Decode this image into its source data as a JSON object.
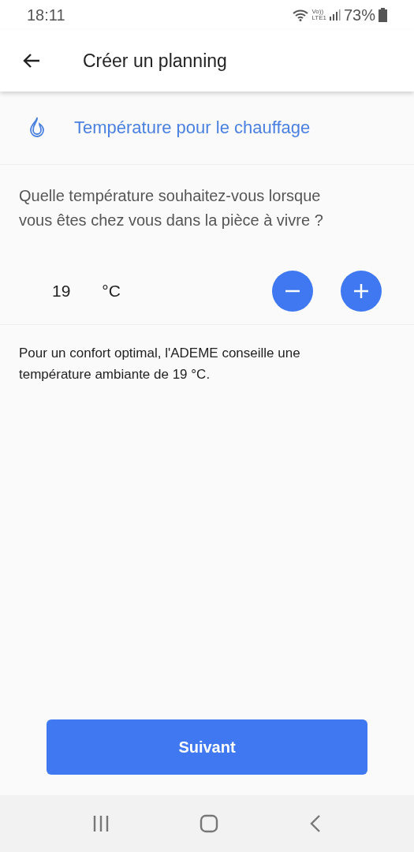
{
  "status_bar": {
    "time": "18:11",
    "volte": "Vo))",
    "network": "LTE1",
    "battery": "73%"
  },
  "app_bar": {
    "title": "Créer un planning"
  },
  "section": {
    "title": "Température pour le chauffage"
  },
  "question": "Quelle température souhaitez-vous lorsque vous êtes chez vous dans la pièce à vivre ?",
  "temperature": {
    "value": "19",
    "unit": "°C"
  },
  "note": "Pour un confort optimal, l'ADEME conseille une température ambiante de 19 °C.",
  "next_button": "Suivant"
}
